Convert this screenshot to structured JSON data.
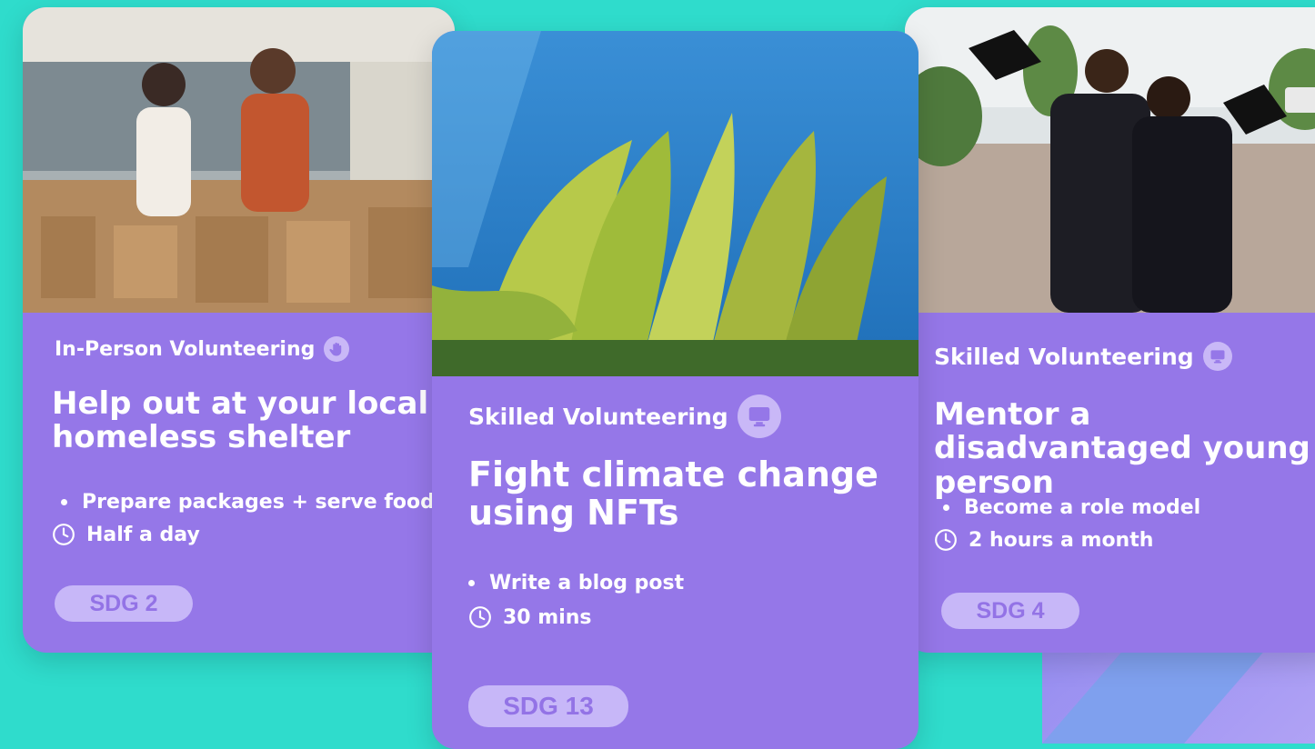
{
  "colors": {
    "background": "#2fdccc",
    "card": "#9577e8",
    "badge_bg": "#c7b7f8",
    "badge_text": "#9373e6"
  },
  "cards": [
    {
      "category": "In-Person Volunteering",
      "category_icon": "hand-icon",
      "title": "Help out at your local homeless shelter",
      "task": "Prepare packages + serve food",
      "duration": "Half a day",
      "sdg": "SDG 2"
    },
    {
      "category": "Skilled Volunteering",
      "category_icon": "monitor-icon",
      "title": "Fight climate change using NFTs",
      "task": "Write a blog post",
      "duration": "30 mins",
      "sdg": "SDG 13"
    },
    {
      "category": "Skilled Volunteering",
      "category_icon": "monitor-icon",
      "title": "Mentor a disadvantaged young person",
      "task": "Become a role model",
      "duration": "2 hours a month",
      "sdg": "SDG 4"
    }
  ]
}
